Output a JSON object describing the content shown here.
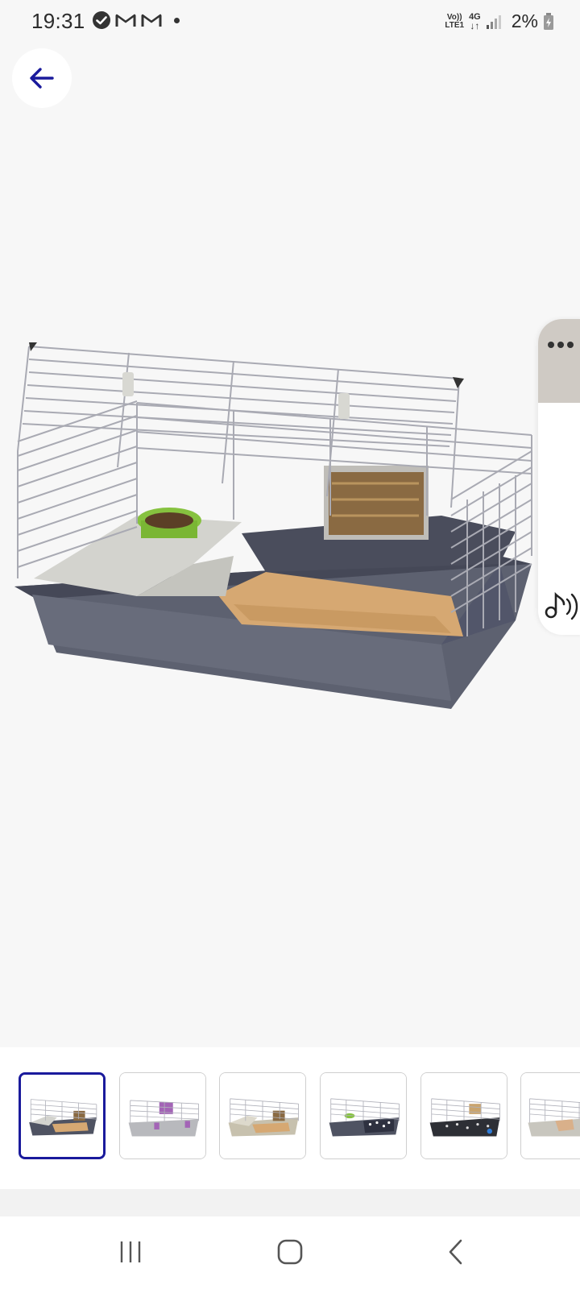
{
  "status_bar": {
    "time": "19:31",
    "left_icons": [
      "check-circle-icon",
      "gmail-icon",
      "gmail-icon",
      "notification-dot-icon"
    ],
    "volte_line1": "Vo))",
    "volte_line2": "LTE1",
    "network_line1": "4G",
    "battery_percent": "2%"
  },
  "navigation": {
    "back_icon": "arrow-left-icon",
    "accent_color": "#1a1a9c"
  },
  "product_image": {
    "subject": "rabbit-cage-grey",
    "selected_index": 0
  },
  "side_widget": {
    "more_icon": "more-dots-icon",
    "audio_icon": "music-note-sound-icon"
  },
  "thumbnails": [
    {
      "variant": "grey-cage-bedding",
      "selected": true
    },
    {
      "variant": "light-grey-cage-purple",
      "selected": false
    },
    {
      "variant": "beige-cage-bedding",
      "selected": false
    },
    {
      "variant": "dark-grey-cage-green-bowl",
      "selected": false
    },
    {
      "variant": "black-cage",
      "selected": false
    },
    {
      "variant": "white-cage-partial",
      "selected": false
    }
  ],
  "system_nav": {
    "recents_icon": "recent-apps-icon",
    "home_icon": "home-icon",
    "back_icon": "system-back-icon"
  }
}
